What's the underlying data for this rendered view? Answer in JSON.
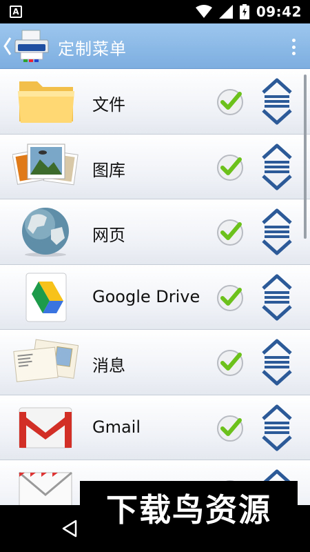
{
  "status_bar": {
    "notification_glyph": "A",
    "time": "09:42"
  },
  "app_bar": {
    "title": "定制菜单"
  },
  "menu_items": [
    {
      "label": "文件",
      "icon": "folder-icon",
      "checked": true
    },
    {
      "label": "图库",
      "icon": "gallery-icon",
      "checked": true
    },
    {
      "label": "网页",
      "icon": "globe-icon",
      "checked": true
    },
    {
      "label": "Google Drive",
      "icon": "google-drive-icon",
      "checked": true
    },
    {
      "label": "消息",
      "icon": "postcard-icon",
      "checked": true
    },
    {
      "label": "Gmail",
      "icon": "gmail-icon",
      "checked": true
    },
    {
      "label": "",
      "icon": "envelope-icon",
      "checked": true
    }
  ],
  "watermark": {
    "text": "下载鸟资源"
  },
  "colors": {
    "accent": "#2c5a99",
    "check_green": "#6cc21a",
    "appbar": "#8ab8e6"
  }
}
